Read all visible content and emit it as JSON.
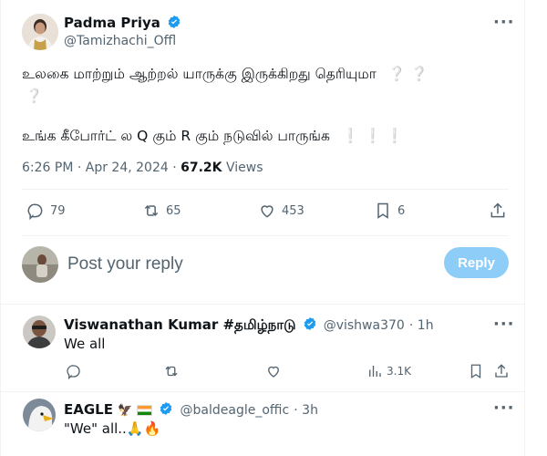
{
  "tweet": {
    "author_name": "Padma Priya",
    "author_handle": "@Tamizhachi_Offl",
    "line1": "உலகை மாற்றும் ஆற்றல் யாருக்கு இருக்கிறது தெரியுமா",
    "line2": "உங்க கீபோர்ட் ல Q கும் R கும் நடுவில் பாருங்க",
    "time": "6:26 PM · Apr 24, 2024 · ",
    "views_count": "67.2K",
    "views_label": " Views",
    "replies": "79",
    "reposts": "65",
    "likes": "453",
    "bookmarks": "6"
  },
  "compose": {
    "placeholder": "Post your reply",
    "reply_button": "Reply"
  },
  "replies": [
    {
      "name": "Viswanathan Kumar #தமிழ்நாடு",
      "handle": "@vishwa370",
      "time": "1h",
      "text": "We all",
      "views": "3.1K"
    },
    {
      "name": "EAGLE",
      "handle": "@baldeagle_offic",
      "time": "3h",
      "text": "\"We\" all..🙏🔥"
    }
  ],
  "colors": {
    "verified": "#1d9bf0",
    "reply_button": "#8ecdf8",
    "muted": "#536471"
  }
}
